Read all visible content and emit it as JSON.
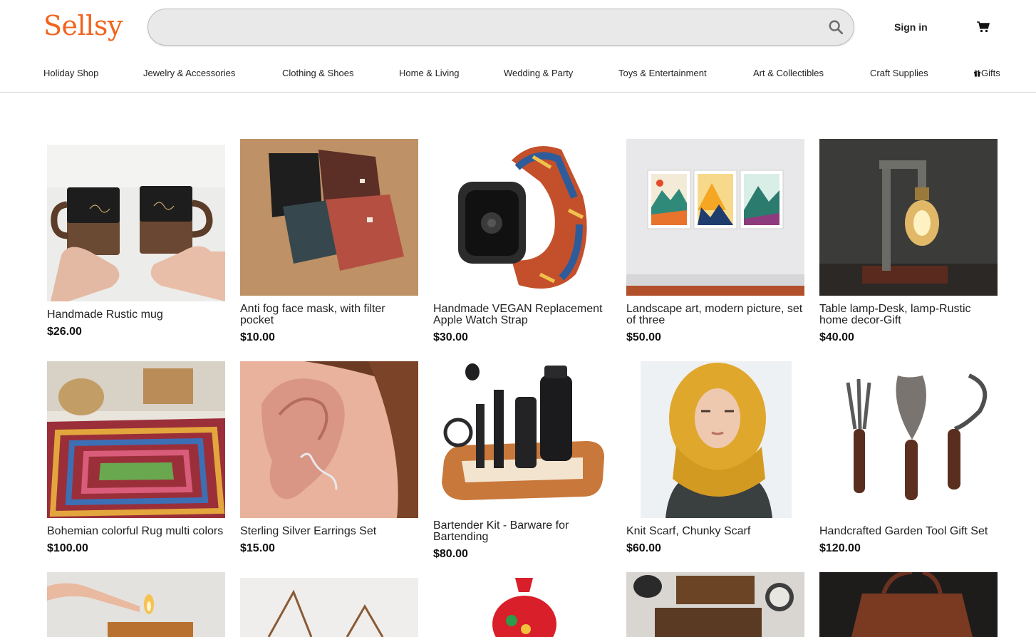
{
  "header": {
    "logo": "Sellsy",
    "search": {
      "value": "",
      "placeholder": ""
    },
    "sign_in": "Sign in",
    "cart_icon": "cart-icon",
    "search_icon": "search-icon"
  },
  "nav": {
    "items": [
      {
        "label": "Holiday Shop"
      },
      {
        "label": "Jewelry & Accessories"
      },
      {
        "label": "Clothing & Shoes"
      },
      {
        "label": "Home & Living"
      },
      {
        "label": "Wedding & Party"
      },
      {
        "label": "Toys & Entertainment"
      },
      {
        "label": "Art & Collectibles"
      },
      {
        "label": "Craft Supplies"
      },
      {
        "label": "Gifts",
        "icon": "gift-icon"
      }
    ]
  },
  "products": [
    {
      "title": "Handmade Rustic mug",
      "price": "$26.00"
    },
    {
      "title": "Anti fog face mask, with filter pocket",
      "price": "$10.00"
    },
    {
      "title": "Handmade VEGAN Replacement Apple Watch Strap",
      "price": "$30.00"
    },
    {
      "title": "Landscape art, modern picture, set of three",
      "price": "$50.00"
    },
    {
      "title": "Table lamp-Desk, lamp-Rustic home decor-Gift",
      "price": "$40.00"
    },
    {
      "title": "Bohemian colorful Rug multi colors",
      "price": "$100.00"
    },
    {
      "title": "Sterling Silver Earrings Set",
      "price": "$15.00"
    },
    {
      "title": "Bartender Kit - Barware for Bartending",
      "price": "$80.00"
    },
    {
      "title": "Knit Scarf, Chunky Scarf",
      "price": "$60.00"
    },
    {
      "title": "Handcrafted Garden Tool Gift Set",
      "price": "$120.00"
    }
  ],
  "colors": {
    "brand": "#f1641e",
    "search_bg": "#e9e9e9",
    "divider": "#d9d9d9"
  }
}
